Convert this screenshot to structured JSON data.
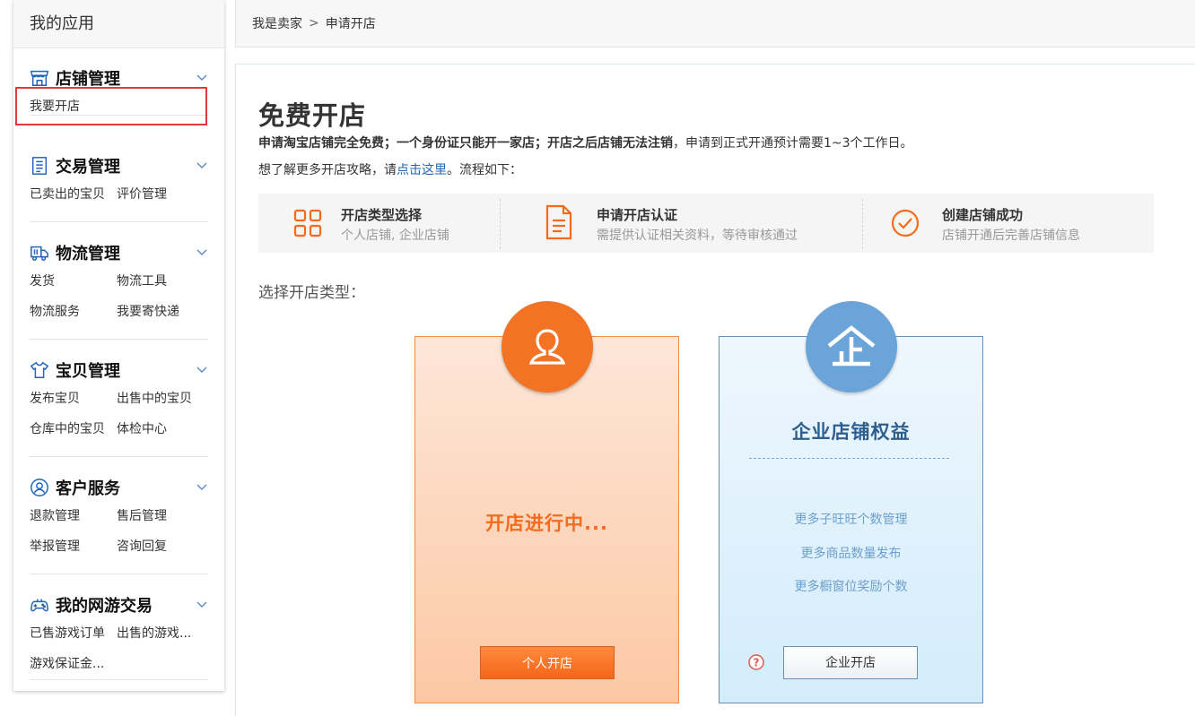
{
  "sidebar": {
    "title": "我的应用",
    "groups": [
      {
        "icon": "store-icon",
        "title": "店铺管理",
        "links": [
          "我要开店"
        ]
      },
      {
        "icon": "receipt-icon",
        "title": "交易管理",
        "links": [
          "已卖出的宝贝",
          "评价管理"
        ]
      },
      {
        "icon": "truck-icon",
        "title": "物流管理",
        "links": [
          "发货",
          "物流工具",
          "物流服务",
          "我要寄快递"
        ]
      },
      {
        "icon": "tshirt-icon",
        "title": "宝贝管理",
        "links": [
          "发布宝贝",
          "出售中的宝贝",
          "仓库中的宝贝",
          "体检中心"
        ]
      },
      {
        "icon": "user-circle-icon",
        "title": "客户服务",
        "links": [
          "退款管理",
          "售后管理",
          "举报管理",
          "咨询回复"
        ]
      },
      {
        "icon": "gamepad-icon",
        "title": "我的网游交易",
        "links": [
          "已售游戏订单",
          "出售的游戏...",
          "游戏保证金..."
        ]
      }
    ]
  },
  "breadcrumb": {
    "parent": "我是卖家",
    "separator": ">",
    "current": "申请开店"
  },
  "main": {
    "title": "免费开店",
    "notice_bold": "申请淘宝店铺完全免费；一个身份证只能开一家店；开店之后店铺无法注销",
    "notice_rest": "，申请到正式开通预计需要1~3个工作日。",
    "guide_prefix": "想了解更多开店攻略，请",
    "guide_link": "点击这里",
    "guide_suffix": "。流程如下：",
    "steps": [
      {
        "icon": "grid-icon",
        "title": "开店类型选择",
        "desc": "个人店铺, 企业店铺"
      },
      {
        "icon": "document-icon",
        "title": "申请开店认证",
        "desc": "需提供认证相关资料，等待审核通过"
      },
      {
        "icon": "check-circle-icon",
        "title": "创建店铺成功",
        "desc": "店铺开通后完善店铺信息"
      }
    ],
    "choose_label": "选择开店类型：",
    "personal": {
      "status": "开店进行中...",
      "button": "个人开店"
    },
    "enterprise": {
      "title": "企业店铺权益",
      "benefits": [
        "更多子旺旺个数管理",
        "更多商品数量发布",
        "更多橱窗位奖励个数"
      ],
      "button": "企业开店"
    }
  },
  "colors": {
    "accent_orange": "#f27323",
    "accent_blue": "#6aa4d8",
    "link_blue": "#1f64b8",
    "selected_border": "#e4393c"
  }
}
